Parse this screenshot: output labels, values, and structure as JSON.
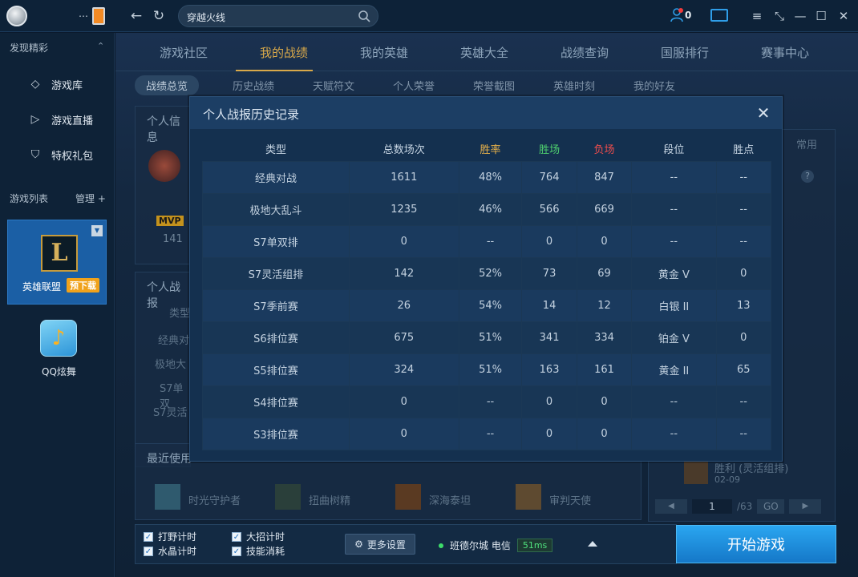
{
  "window": {
    "search_value": "穿越火线",
    "notification_count": "0"
  },
  "sidebar": {
    "discover_title": "发现精彩",
    "items": [
      {
        "label": "游戏库",
        "icon": "diamond-icon"
      },
      {
        "label": "游戏直播",
        "icon": "play-circle-icon"
      },
      {
        "label": "特权礼包",
        "icon": "shield-icon"
      }
    ],
    "games_title": "游戏列表",
    "manage_label": "管理 +",
    "games": [
      {
        "name": "英雄联盟",
        "badge": "预下载",
        "icon_letter": "L"
      },
      {
        "name": "QQ炫舞"
      }
    ]
  },
  "main": {
    "tabs": [
      "游戏社区",
      "我的战绩",
      "我的英雄",
      "英雄大全",
      "战绩查询",
      "国服排行",
      "赛事中心"
    ],
    "subtabs": [
      "战绩总览",
      "历史战绩",
      "天赋符文",
      "个人荣誉",
      "荣誉截图",
      "英雄时刻",
      "我的好友"
    ],
    "bg": {
      "info_title": "个人信息",
      "mvp_label": "MVP",
      "mvp_count": "141",
      "record_title": "个人战报",
      "record_col": "类型",
      "record_rows": [
        "经典对",
        "极地大",
        "S7单双",
        "S7灵活"
      ],
      "recent_title": "最近使用",
      "recent_heroes": [
        "时光守护者",
        "扭曲树精",
        "深海泰坦",
        "审判天使"
      ],
      "right_common": "常用",
      "right_result": "胜利 (灵活组排)",
      "right_date": "02-09",
      "page_current": "1",
      "page_total": "/63",
      "go_label": "GO"
    }
  },
  "modal": {
    "title": "个人战报历史记录",
    "columns": [
      "类型",
      "总数场次",
      "胜率",
      "胜场",
      "负场",
      "段位",
      "胜点"
    ],
    "rows": [
      [
        "经典对战",
        "1611",
        "48%",
        "764",
        "847",
        "--",
        "--"
      ],
      [
        "极地大乱斗",
        "1235",
        "46%",
        "566",
        "669",
        "--",
        "--"
      ],
      [
        "S7单双排",
        "0",
        "--",
        "0",
        "0",
        "--",
        "--"
      ],
      [
        "S7灵活组排",
        "142",
        "52%",
        "73",
        "69",
        "黄金 V",
        "0"
      ],
      [
        "S7季前赛",
        "26",
        "54%",
        "14",
        "12",
        "白银 II",
        "13"
      ],
      [
        "S6排位赛",
        "675",
        "51%",
        "341",
        "334",
        "铂金 V",
        "0"
      ],
      [
        "S5排位赛",
        "324",
        "51%",
        "163",
        "161",
        "黄金 II",
        "65"
      ],
      [
        "S4排位赛",
        "0",
        "--",
        "0",
        "0",
        "--",
        "--"
      ],
      [
        "S3排位赛",
        "0",
        "--",
        "0",
        "0",
        "--",
        "--"
      ]
    ]
  },
  "bottom": {
    "checks": [
      "打野计时",
      "大招计时",
      "水晶计时",
      "技能消耗"
    ],
    "more_settings": "更多设置",
    "server": "班德尔城 电信",
    "ping": "51ms",
    "start": "开始游戏"
  },
  "colors": {
    "accent_gold": "#d9a94a",
    "win_green": "#4ecf6e",
    "loss_red": "#ef4d4d",
    "start_blue": "#1f8fe0"
  }
}
